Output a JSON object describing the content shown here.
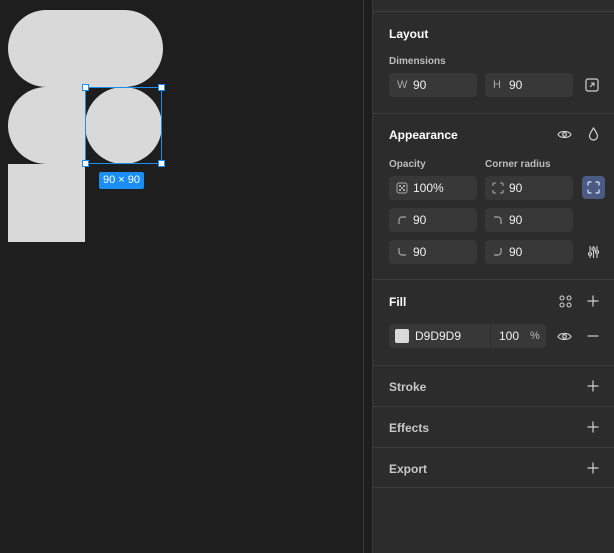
{
  "canvas": {
    "selection_badge": "90 × 90"
  },
  "layout": {
    "title": "Layout",
    "dimensions_label": "Dimensions",
    "width": {
      "prefix": "W",
      "value": "90"
    },
    "height": {
      "prefix": "H",
      "value": "90"
    }
  },
  "appearance": {
    "title": "Appearance",
    "opacity_label": "Opacity",
    "opacity_value": "100%",
    "corner_radius_label": "Corner radius",
    "corner_radius_value": "90",
    "corner_top_left": "90",
    "corner_top_right": "90",
    "corner_bottom_left": "90",
    "corner_bottom_right": "90"
  },
  "fill": {
    "title": "Fill",
    "color_hex": "D9D9D9",
    "swatch_color": "#d9d9d9",
    "opacity": "100",
    "opacity_unit": "%"
  },
  "stroke": {
    "title": "Stroke"
  },
  "effects": {
    "title": "Effects"
  },
  "export": {
    "title": "Export"
  },
  "colors": {
    "selection": "#1b8ef2",
    "active_toggle": "#4a5a82"
  }
}
